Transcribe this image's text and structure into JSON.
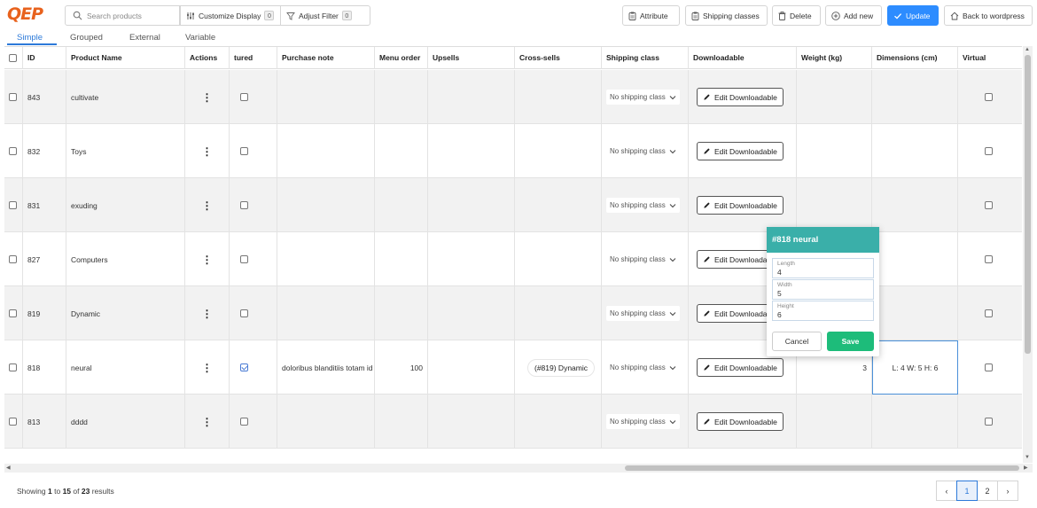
{
  "brand": {
    "logo_text": "QEP",
    "accent": "#e8621d"
  },
  "toolbar": {
    "search_placeholder": "Search products",
    "customize_label": "Customize Display",
    "customize_count": "0",
    "filter_label": "Adjust Filter",
    "filter_count": "0",
    "attribute_label": "Attribute",
    "shipping_classes_label": "Shipping classes",
    "delete_label": "Delete",
    "add_new_label": "Add new",
    "update_label": "Update",
    "back_label": "Back to wordpress",
    "primary_color": "#2d8cff"
  },
  "tabs": [
    {
      "label": "Simple",
      "active": true
    },
    {
      "label": "Grouped",
      "active": false
    },
    {
      "label": "External",
      "active": false
    },
    {
      "label": "Variable",
      "active": false
    }
  ],
  "columns": {
    "id": "ID",
    "name": "Product Name",
    "actions": "Actions",
    "featured": "tured",
    "purchase_note": "Purchase note",
    "menu_order": "Menu order",
    "upsells": "Upsells",
    "cross_sells": "Cross-sells",
    "shipping_class": "Shipping class",
    "downloadable": "Downloadable",
    "weight": "Weight (kg)",
    "dimensions": "Dimensions (cm)",
    "virtual": "Virtual"
  },
  "rows": [
    {
      "id": "843",
      "name": "cultivate",
      "featured": false,
      "purchase_note": "",
      "menu_order": "",
      "cross_sells": "",
      "shipping": "No shipping class",
      "download_label": "Edit Downloadable",
      "weight": "",
      "dimensions": ""
    },
    {
      "id": "832",
      "name": "Toys",
      "featured": false,
      "purchase_note": "",
      "menu_order": "",
      "cross_sells": "",
      "shipping": "No shipping class",
      "download_label": "Edit Downloadable",
      "weight": "",
      "dimensions": ""
    },
    {
      "id": "831",
      "name": "exuding",
      "featured": false,
      "purchase_note": "",
      "menu_order": "",
      "cross_sells": "",
      "shipping": "No shipping class",
      "download_label": "Edit Downloadable",
      "weight": "",
      "dimensions": ""
    },
    {
      "id": "827",
      "name": "Computers",
      "featured": false,
      "purchase_note": "",
      "menu_order": "",
      "cross_sells": "",
      "shipping": "No shipping class",
      "download_label": "Edit Downloadable",
      "weight": "",
      "dimensions": ""
    },
    {
      "id": "819",
      "name": "Dynamic",
      "featured": false,
      "purchase_note": "",
      "menu_order": "",
      "cross_sells": "",
      "shipping": "No shipping class",
      "download_label": "Edit Downloadable",
      "weight": "",
      "dimensions": ""
    },
    {
      "id": "818",
      "name": "neural",
      "featured": true,
      "purchase_note": "doloribus blanditiis totam id e",
      "menu_order": "100",
      "cross_sells": "(#819) Dynamic",
      "shipping": "No shipping class",
      "download_label": "Edit Downloadable",
      "weight": "3",
      "dimensions": "L: 4 W: 5 H: 6"
    },
    {
      "id": "813",
      "name": "dddd",
      "featured": false,
      "purchase_note": "",
      "menu_order": "",
      "cross_sells": "",
      "shipping": "No shipping class",
      "download_label": "Edit Downloadable",
      "weight": "",
      "dimensions": ""
    }
  ],
  "popup": {
    "title": "#818 neural",
    "length_label": "Length",
    "length_value": "4",
    "width_label": "Width",
    "width_value": "5",
    "height_label": "Height",
    "height_value": "6",
    "cancel_label": "Cancel",
    "save_label": "Save",
    "header_color": "#3aafa9",
    "save_color": "#1dbc7a"
  },
  "footer": {
    "showing_prefix": "Showing",
    "from": "1",
    "to_word": "to",
    "to": "15",
    "of_word": "of",
    "total": "23",
    "results_word": "results",
    "pages": [
      "1",
      "2"
    ],
    "current_page": "1"
  }
}
